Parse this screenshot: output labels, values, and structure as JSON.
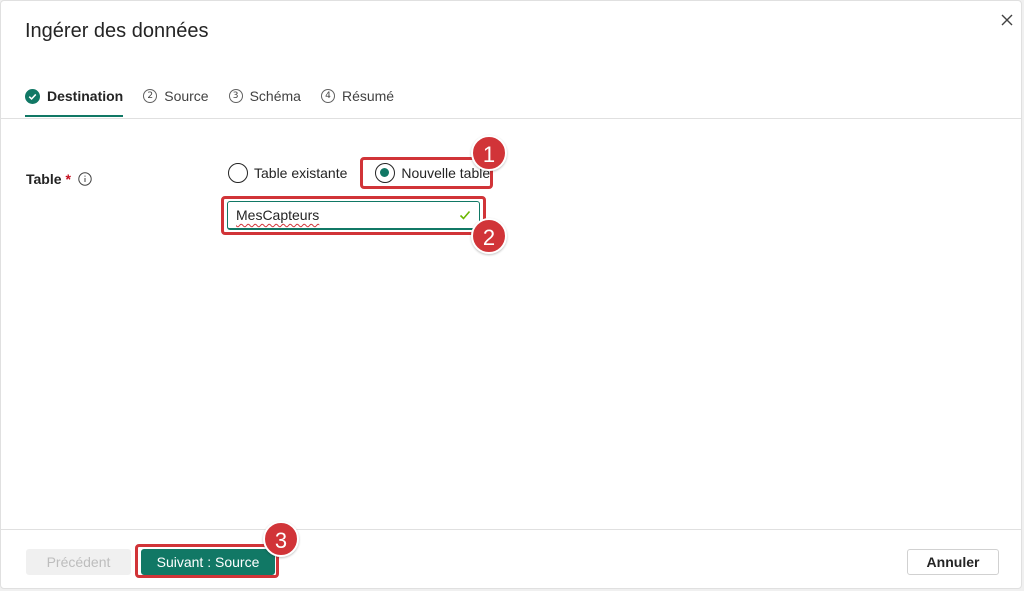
{
  "dialog": {
    "title": "Ingérer des données",
    "close_icon": "close-icon"
  },
  "tabs": [
    {
      "label": "Destination",
      "number": "",
      "state": "completed"
    },
    {
      "label": "Source",
      "number": "2"
    },
    {
      "label": "Schéma",
      "number": "3"
    },
    {
      "label": "Résumé",
      "number": "4"
    }
  ],
  "form": {
    "table_label": "Table",
    "required_marker": "*",
    "options": {
      "existing": "Table existante",
      "new": "Nouvelle table"
    },
    "selected_option": "Nouvelle table",
    "table_name_value": "MesCapteurs"
  },
  "annotations": {
    "badge1": "1",
    "badge2": "2",
    "badge3": "3",
    "color": "#d13438"
  },
  "footer": {
    "prev_label": "Précédent",
    "next_label": "Suivant : Source",
    "cancel_label": "Annuler"
  },
  "colors": {
    "accent": "#117865",
    "highlight": "#d13438"
  }
}
